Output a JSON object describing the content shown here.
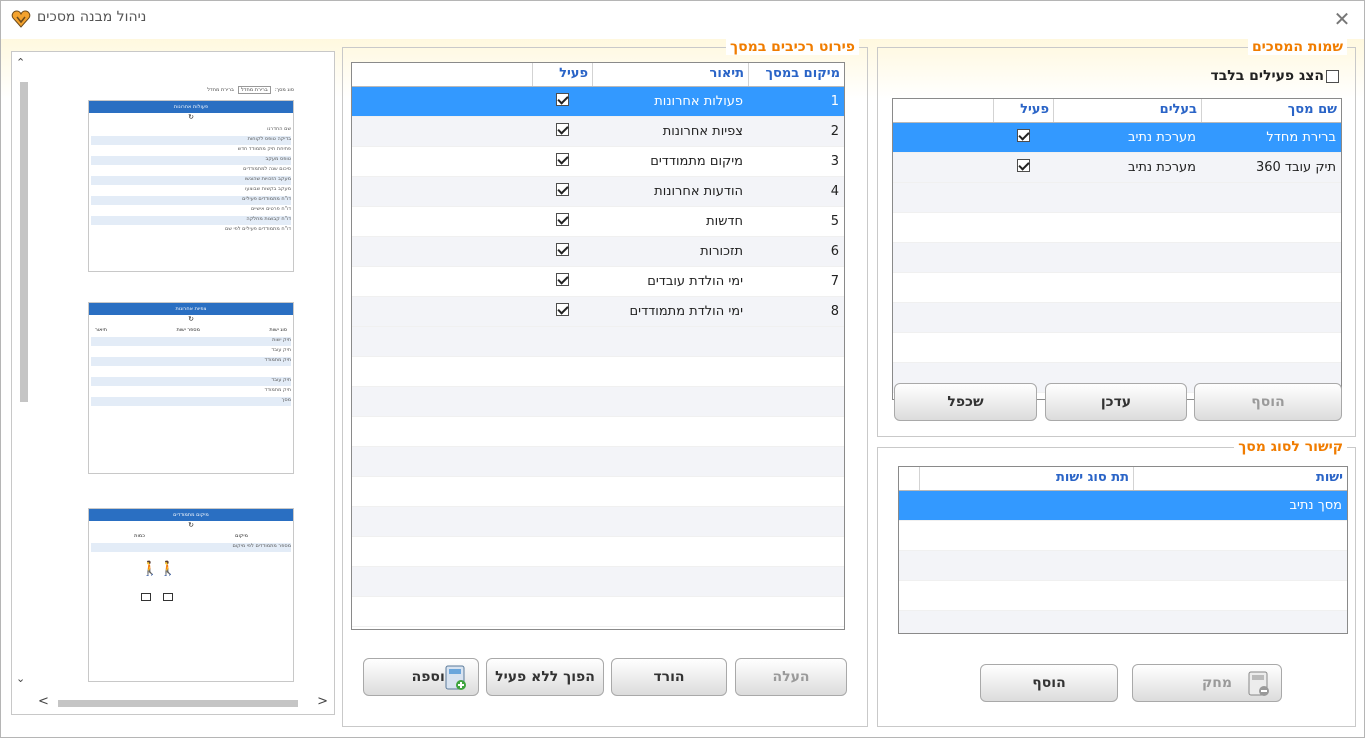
{
  "window": {
    "title": "ניהול מבנה מסכים",
    "close_icon": "close-icon",
    "accent": "#f07c00"
  },
  "screens_group": {
    "title": "שמות המסכים",
    "show_active_label": "הצג פעילים בלבד",
    "show_active_checked": false,
    "columns": [
      "שם מסך",
      "בעלים",
      "פעיל"
    ],
    "rows": [
      {
        "name": "ברירת מחדל",
        "owner": "מערכת נתיב",
        "active": true
      },
      {
        "name": "תיק עובד 360",
        "owner": "מערכת נתיב",
        "active": true
      }
    ],
    "buttons": {
      "add": "הוסף",
      "update": "עדכן",
      "duplicate": "שכפל"
    }
  },
  "link_group": {
    "title": "קישור לסוג מסך",
    "columns": [
      "ישות",
      "תת סוג ישות"
    ],
    "rows": [
      {
        "entity": "מסך נתיב",
        "subtype": ""
      }
    ],
    "buttons": {
      "delete": "מחק",
      "add": "הוסף"
    }
  },
  "components_group": {
    "title": "פירוט רכיבים במסך",
    "columns": [
      "מיקום במסך",
      "תיאור",
      "פעיל"
    ],
    "rows": [
      {
        "pos": "1",
        "desc": "פעולות אחרונות",
        "active": true
      },
      {
        "pos": "2",
        "desc": "צפיות אחרונות",
        "active": true
      },
      {
        "pos": "3",
        "desc": "מיקום מתמודדים",
        "active": true
      },
      {
        "pos": "4",
        "desc": "הודעות אחרונות",
        "active": true
      },
      {
        "pos": "5",
        "desc": "חדשות",
        "active": true
      },
      {
        "pos": "6",
        "desc": "תזכורות",
        "active": true
      },
      {
        "pos": "7",
        "desc": "ימי הולדת עובדים",
        "active": true
      },
      {
        "pos": "8",
        "desc": "ימי הולדת מתמודדים",
        "active": true
      }
    ],
    "buttons": {
      "up": "העלה",
      "down": "הורד",
      "toggle_inactive": "הפוך ללא פעיל",
      "add": "הוספה"
    }
  },
  "preview": {
    "top_labels": {
      "screen_type": "סוג מסך:",
      "default": "ברירת מחדל",
      "default_check": "ברירת מחדל"
    },
    "card1": {
      "title": "פעולות אחרונות",
      "lines": [
        "שם החדרנו",
        "בדיקה טופס לקוחות",
        "פתיחת תיק מתמודד חדש",
        "טופס מעקב",
        "סיכום שנה למתמודדים",
        "מעקב הזכויות שהוגשו",
        "מעקב בקשות שבוצעו",
        "דו\"ח מתמודדים פעילים",
        "דו\"ח פרטים אישיים",
        "דו\"ח קבוצות מחלקה",
        "דו\"ח מתמודדים פעילים לפי שם"
      ]
    },
    "card2": {
      "title": "צפיות אחרונות",
      "cols": [
        "סוג ישות",
        "מספר ישות",
        "תיאור"
      ],
      "lines": [
        "תיק ישות",
        "תיק עובד",
        "תיק מתמודד",
        "",
        "תיק עובד",
        "תיק מתמודד",
        "מסך"
      ]
    },
    "card3": {
      "title": "מיקום מתמודדים",
      "cols": [
        "מיקום",
        "כמות"
      ],
      "line": "מספר מתמודדים לפי מיקום"
    }
  }
}
